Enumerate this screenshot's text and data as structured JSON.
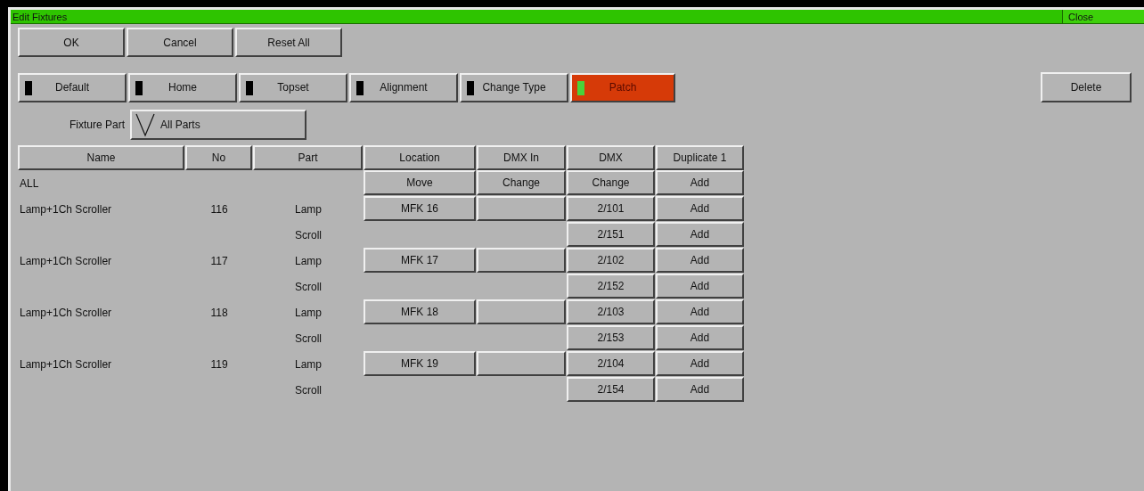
{
  "window": {
    "title": "Edit Fixtures",
    "close": "Close"
  },
  "actions": [
    "OK",
    "Cancel",
    "Reset All"
  ],
  "modes": [
    {
      "label": "Default",
      "selected": false
    },
    {
      "label": "Home",
      "selected": false
    },
    {
      "label": "Topset",
      "selected": false
    },
    {
      "label": "Alignment",
      "selected": false
    },
    {
      "label": "Change Type",
      "selected": false
    },
    {
      "label": "Patch",
      "selected": true
    }
  ],
  "delete": "Delete",
  "fixture_part": {
    "label": "Fixture Part",
    "value": "All Parts"
  },
  "table": {
    "columns": [
      "Name",
      "No",
      "Part",
      "Location",
      "DMX In",
      "DMX",
      "Duplicate 1"
    ],
    "rows": [
      [
        {
          "kind": "text",
          "text": "ALL"
        },
        {
          "kind": "blank"
        },
        {
          "kind": "blank"
        },
        {
          "kind": "button",
          "text": "Move"
        },
        {
          "kind": "button",
          "text": "Change"
        },
        {
          "kind": "button",
          "text": "Change"
        },
        {
          "kind": "button",
          "text": "Add"
        }
      ],
      [
        {
          "kind": "text",
          "text": "Lamp+1Ch Scroller"
        },
        {
          "kind": "text",
          "text": "116"
        },
        {
          "kind": "text",
          "text": "Lamp"
        },
        {
          "kind": "button",
          "text": "MFK 16"
        },
        {
          "kind": "button"
        },
        {
          "kind": "button",
          "text": "2/101"
        },
        {
          "kind": "button",
          "text": "Add"
        }
      ],
      [
        {
          "kind": "blank"
        },
        {
          "kind": "blank"
        },
        {
          "kind": "text",
          "text": "Scroll"
        },
        {
          "kind": "blank"
        },
        {
          "kind": "blank"
        },
        {
          "kind": "button",
          "text": "2/151"
        },
        {
          "kind": "button",
          "text": "Add"
        }
      ],
      [
        {
          "kind": "text",
          "text": "Lamp+1Ch Scroller"
        },
        {
          "kind": "text",
          "text": "117"
        },
        {
          "kind": "text",
          "text": "Lamp"
        },
        {
          "kind": "button",
          "text": "MFK 17"
        },
        {
          "kind": "button"
        },
        {
          "kind": "button",
          "text": "2/102"
        },
        {
          "kind": "button",
          "text": "Add"
        }
      ],
      [
        {
          "kind": "blank"
        },
        {
          "kind": "blank"
        },
        {
          "kind": "text",
          "text": "Scroll"
        },
        {
          "kind": "blank"
        },
        {
          "kind": "blank"
        },
        {
          "kind": "button",
          "text": "2/152"
        },
        {
          "kind": "button",
          "text": "Add"
        }
      ],
      [
        {
          "kind": "text",
          "text": "Lamp+1Ch Scroller"
        },
        {
          "kind": "text",
          "text": "118"
        },
        {
          "kind": "text",
          "text": "Lamp"
        },
        {
          "kind": "button",
          "text": "MFK 18"
        },
        {
          "kind": "button"
        },
        {
          "kind": "button",
          "text": "2/103"
        },
        {
          "kind": "button",
          "text": "Add"
        }
      ],
      [
        {
          "kind": "blank"
        },
        {
          "kind": "blank"
        },
        {
          "kind": "text",
          "text": "Scroll"
        },
        {
          "kind": "blank"
        },
        {
          "kind": "blank"
        },
        {
          "kind": "button",
          "text": "2/153"
        },
        {
          "kind": "button",
          "text": "Add"
        }
      ],
      [
        {
          "kind": "text",
          "text": "Lamp+1Ch Scroller"
        },
        {
          "kind": "text",
          "text": "119"
        },
        {
          "kind": "text",
          "text": "Lamp"
        },
        {
          "kind": "button",
          "text": "MFK 19"
        },
        {
          "kind": "button"
        },
        {
          "kind": "button",
          "text": "2/104"
        },
        {
          "kind": "button",
          "text": "Add"
        }
      ],
      [
        {
          "kind": "blank"
        },
        {
          "kind": "blank"
        },
        {
          "kind": "text",
          "text": "Scroll"
        },
        {
          "kind": "blank"
        },
        {
          "kind": "blank"
        },
        {
          "kind": "button",
          "text": "2/154"
        },
        {
          "kind": "button",
          "text": "Add"
        }
      ]
    ]
  }
}
